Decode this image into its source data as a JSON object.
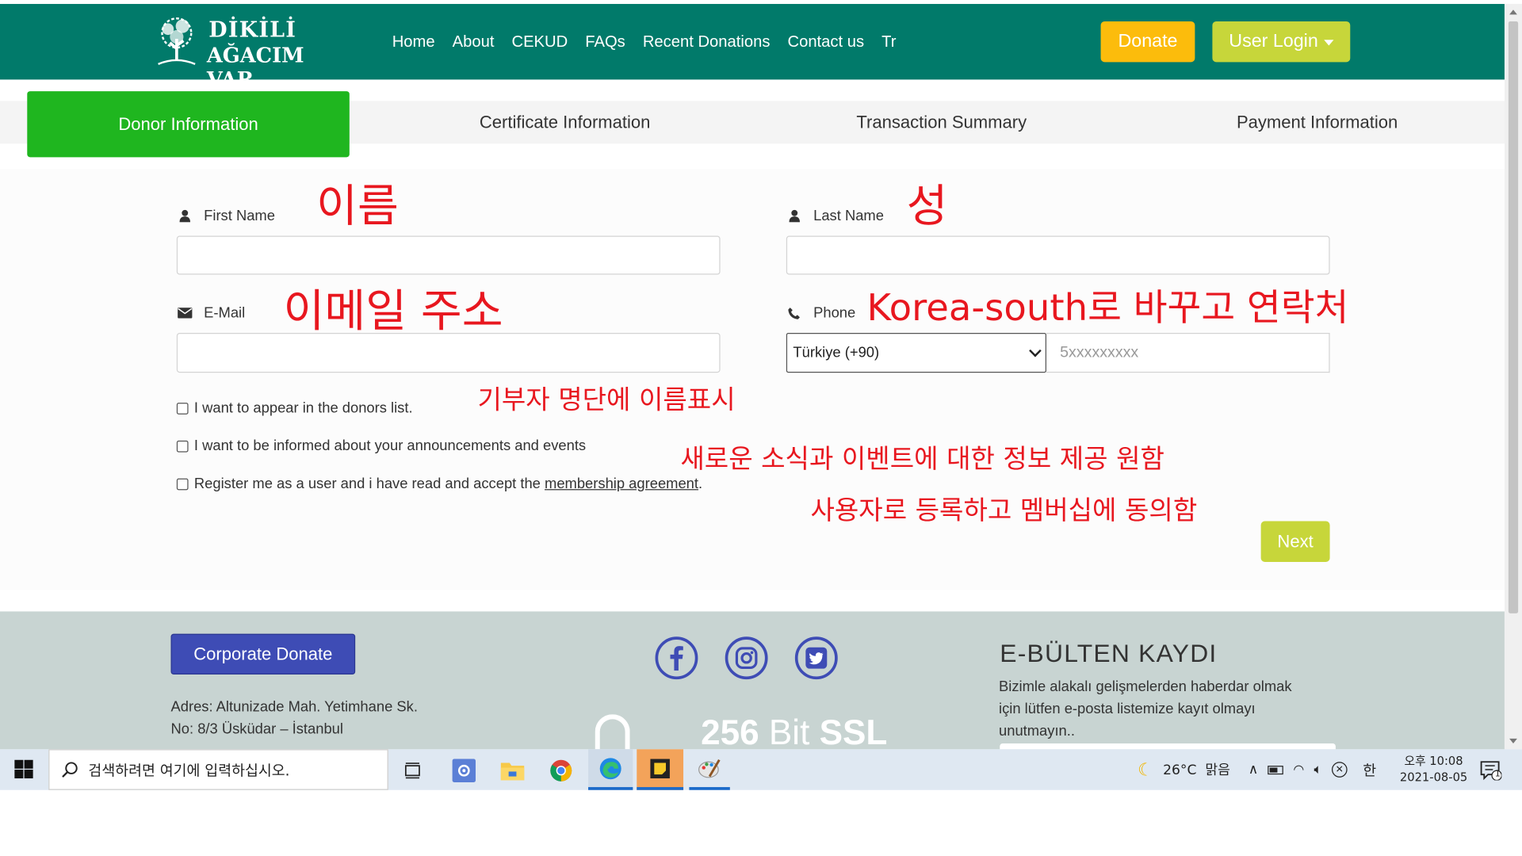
{
  "navbar": {
    "logo_line1": "DİKİLİ",
    "logo_line2": "AĞACIM VAR",
    "links": [
      "Home",
      "About",
      "CEKUD",
      "FAQs",
      "Recent Donations",
      "Contact us",
      "Tr"
    ],
    "donate_label": "Donate",
    "login_label": "User Login"
  },
  "steps": {
    "items": [
      "Donor Information",
      "Certificate Information",
      "Transaction Summary",
      "Payment Information"
    ],
    "active_index": 0
  },
  "form": {
    "first_name_label": "First Name",
    "last_name_label": "Last Name",
    "email_label": "E-Mail",
    "phone_label": "Phone",
    "first_name_value": "",
    "last_name_value": "",
    "email_value": "",
    "country_code_selected": "Türkiye (+90)",
    "phone_placeholder": "5xxxxxxxxx",
    "checkbox_donors_list": "I want to appear in the donors list.",
    "checkbox_informed": "I want to be informed about your announcements and events",
    "checkbox_register_prefix": "Register me as a user and i have read and accept the ",
    "checkbox_register_link": "membership agreement",
    "checkbox_register_suffix": ".",
    "next_label": "Next"
  },
  "annotations": {
    "first_name": "이름",
    "last_name": "성",
    "email": "이메일 주소",
    "phone": "Korea-south로 바꾸고 연락처",
    "donors_list": "기부자 명단에 이름표시",
    "informed": "새로운 소식과 이벤트에 대한 정보 제공 원함",
    "register": "사용자로 등록하고 멤버십에 동의함",
    "color": "#e8171f"
  },
  "footer": {
    "corporate_donate_label": "Corporate Donate",
    "address_line1": "Adres: Altunizade Mah. Yetimhane Sk.",
    "address_line2": "No: 8/3 Üsküdar – İstanbul",
    "social": [
      "facebook-icon",
      "instagram-icon",
      "twitter-icon"
    ],
    "ssl_number": "256",
    "ssl_bit": " Bit ",
    "ssl_text": "SSL",
    "ebulten_title": "E-BÜLTEN KAYDI",
    "ebulten_text": "Bizimle alakalı gelişmelerden haberdar olmak için lütfen e-posta listemize kayıt olmayı unutmayın.."
  },
  "taskbar": {
    "search_placeholder": "검색하려면 여기에 입력하십시오.",
    "weather": "26°C  맑음",
    "ime": "한",
    "time_line1": "오후 10:08",
    "time_line2": "2021-08-05",
    "notification_count": "1"
  },
  "colors": {
    "navbar": "#017a6a",
    "donate": "#fcbc0c",
    "login": "#c7d63a",
    "step_active": "#1fb61f",
    "corporate": "#3e4cb5",
    "footer": "#c8d4d2"
  }
}
